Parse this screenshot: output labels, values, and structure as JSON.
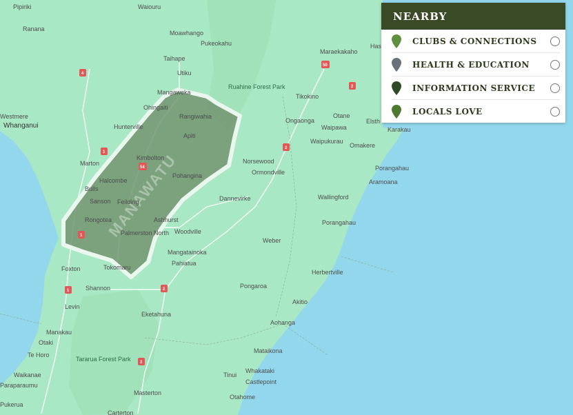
{
  "panel": {
    "title": "NEARBY",
    "items": [
      {
        "label": "CLUBS & CONNECTIONS",
        "pin_color": "#5e8f3e",
        "icon": "map-pin-icon"
      },
      {
        "label": "HEALTH & EDUCATION",
        "pin_color": "#6a7278",
        "icon": "map-pin-icon"
      },
      {
        "label": "INFORMATION SERVICE",
        "pin_color": "#2f4a25",
        "icon": "map-pin-icon"
      },
      {
        "label": "LOCALS LOVE",
        "pin_color": "#4f7a34",
        "icon": "map-pin-icon"
      }
    ]
  },
  "map": {
    "region_label": "MANAWATU",
    "colors": {
      "sea": "#93d7ec",
      "land": "#a9e8c4",
      "region": "#6f8f6b",
      "region_border": "#eaf7ee"
    },
    "places": [
      "Pipiriki",
      "Waiouru",
      "Ranana",
      "Moawhango",
      "Pukeokahu",
      "Taihape",
      "Utiku",
      "Maraekakaho",
      "Has",
      "Ruahine Forest Park",
      "Mangaweka",
      "Ohingaiti",
      "Tikokino",
      "Westmere",
      "Whanganui",
      "Hunterville",
      "Rangiwahia",
      "Apiti",
      "Otane",
      "Ongaonga",
      "Waipawa",
      "Elsth",
      "Karakau",
      "Waipukurau",
      "Omakere",
      "Marton",
      "Kimbolton",
      "Norsewood",
      "Ormondville",
      "Porangahau",
      "Bulls",
      "Halcombe",
      "Pohangina",
      "Aramoana",
      "Sanson",
      "Feilding",
      "Dannevirke",
      "Wallingford",
      "Rongotea",
      "Ashhurst",
      "Porangahau",
      "Woodville",
      "Palmerston North",
      "Weber",
      "Mangatainoka",
      "Foxton",
      "Pahiatua",
      "Tokomaru",
      "Herbertville",
      "Shannon",
      "Pongaroa",
      "Akitio",
      "Levin",
      "Eketahuna",
      "Aohanga",
      "Manakau",
      "Otaki",
      "Mataikona",
      "Te Horo",
      "Tararua Forest Park",
      "Tinui",
      "Waikanae",
      "Whakataki",
      "Castlepoint",
      "Paraparaumu",
      "Masterton",
      "Otahome",
      "Pukerua",
      "Carterton"
    ],
    "highways": [
      "4",
      "50",
      "2",
      "1",
      "54",
      "1",
      "2",
      "2",
      "1",
      "2"
    ]
  }
}
